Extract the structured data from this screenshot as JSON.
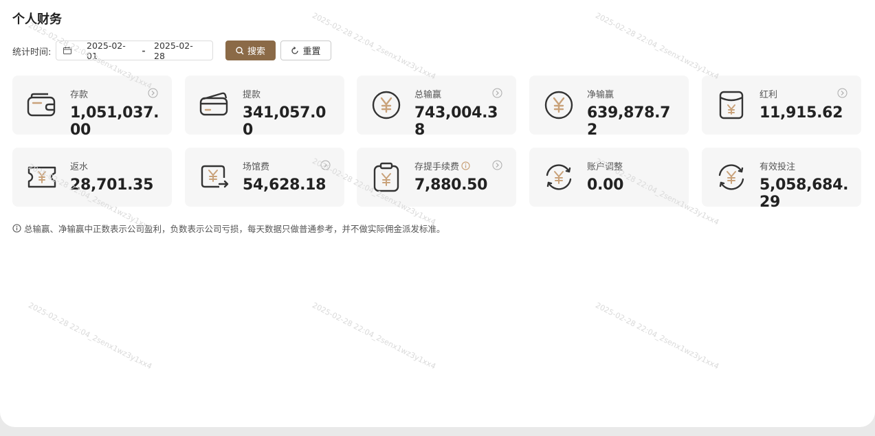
{
  "page": {
    "title": "个人财务"
  },
  "filter": {
    "label": "统计时间:",
    "start_date": "2025-02-01",
    "separator": "-",
    "end_date": "2025-02-28",
    "search_label": "搜索",
    "reset_label": "重置"
  },
  "cards": [
    {
      "label": "存款",
      "value": "1,051,037.00",
      "icon": "wallet-icon",
      "has_arrow": true
    },
    {
      "label": "提款",
      "value": "341,057.00",
      "icon": "card-wallet-icon",
      "has_arrow": false
    },
    {
      "label": "总输赢",
      "value": "743,004.38",
      "icon": "yen-circle-icon",
      "has_arrow": true
    },
    {
      "label": "净输赢",
      "value": "639,878.72",
      "icon": "yen-circle-icon",
      "has_arrow": false
    },
    {
      "label": "红利",
      "value": "11,915.62",
      "icon": "red-envelope-icon",
      "has_arrow": true
    },
    {
      "label": "返水",
      "value": "28,701.35",
      "icon": "ticket-icon",
      "has_arrow": false
    },
    {
      "label": "场馆费",
      "value": "54,628.18",
      "icon": "venue-fee-icon",
      "has_arrow": true
    },
    {
      "label": "存提手续费",
      "value": "7,880.50",
      "icon": "clipboard-yen-icon",
      "has_arrow": true,
      "has_info": true
    },
    {
      "label": "账户调整",
      "value": "0.00",
      "icon": "yen-refresh-icon",
      "has_arrow": false
    },
    {
      "label": "有效投注",
      "value": "5,058,684.29",
      "icon": "yen-refresh-icon",
      "has_arrow": false
    }
  ],
  "note": "总输赢、净输赢中正数表示公司盈利，负数表示公司亏损，每天数据只做普通参考，并不做实际佣金派发标准。",
  "watermark": "2025-02-28 22:04_2senx1wz3y1xx4",
  "colors": {
    "accent": "#8b6a47",
    "icon_gold": "#c9a27a",
    "icon_stroke": "#333333"
  }
}
